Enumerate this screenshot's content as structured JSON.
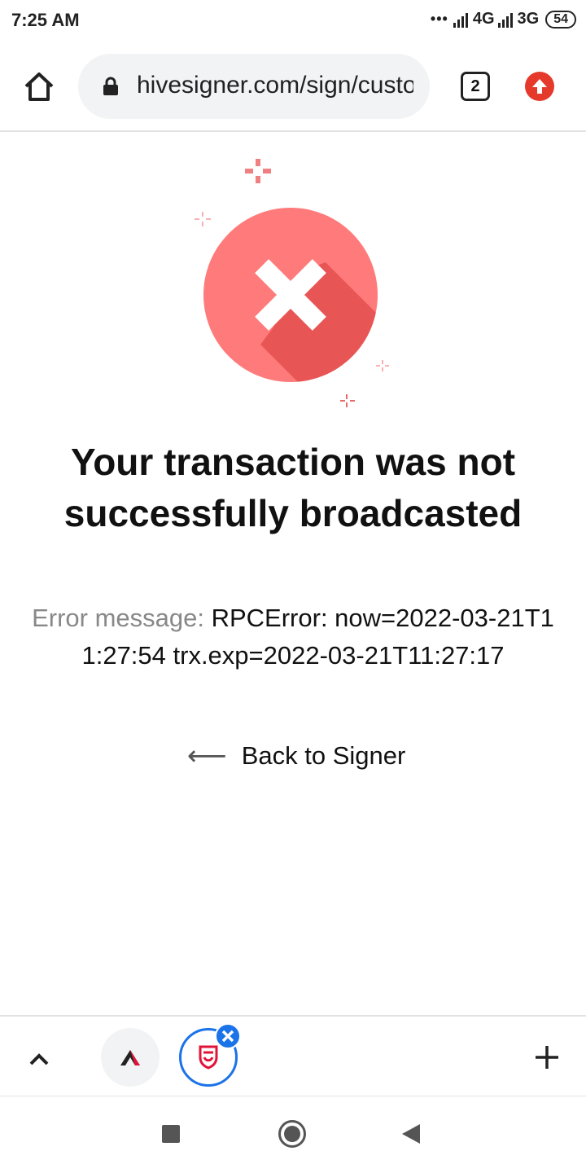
{
  "status_bar": {
    "time": "7:25 AM",
    "dots": "•••",
    "network_1": "4G",
    "network_2": "3G",
    "battery": "54"
  },
  "toolbar": {
    "url": "hivesigner.com/sign/custom-json",
    "tab_count": "2"
  },
  "main": {
    "title": "Your transaction was not successfully broadcasted",
    "error_label": "Error message:",
    "error_text": "RPCError: now=2022-03-21T11:27:54 trx.exp=2022-03-21T11:27:17",
    "back_arrow": "⟵",
    "back_label": "Back to Signer"
  },
  "colors": {
    "error_circle": "#ff7a7a",
    "error_shadow": "#e85555",
    "sparkle": "#f08080",
    "tab_accent": "#1a73e8",
    "update_badge": "#e4392b"
  }
}
